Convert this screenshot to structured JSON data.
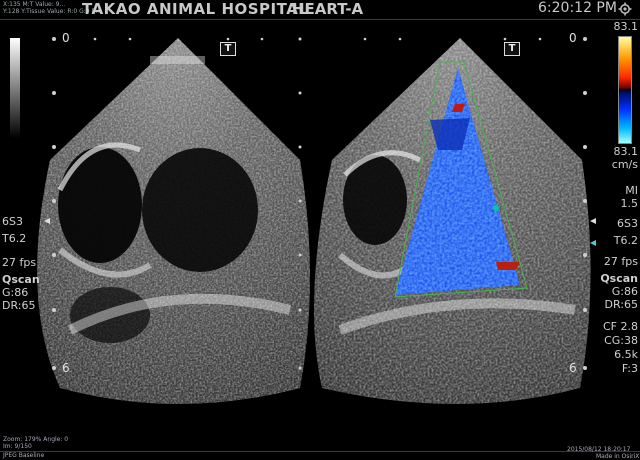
{
  "header": {
    "info_line1": "X:135 M:T Value: 9...",
    "info_line2": "Y:128  Y:Tissue Value: R:0 G:0 B:0",
    "hospital": "TAKAO ANIMAL HOSPITAL",
    "preset": "HEART-A",
    "time": "6:20:12 PM"
  },
  "left_panel": {
    "depth_top": "0",
    "depth_bottom": "6",
    "probe": "6S3",
    "tissue_freq": "T6.2",
    "fps": "27 fps",
    "mode": "Qscan",
    "gain": "G:86",
    "dynamic_range": "DR:65",
    "marker": "T"
  },
  "right_panel": {
    "depth_top": "0",
    "depth_bottom": "6",
    "scale_top": "83.1",
    "scale_bottom": "83.1",
    "scale_unit": "cm/s",
    "mi_label": "MI",
    "mi_value": "1.5",
    "probe": "6S3",
    "tissue_freq": "T6.2",
    "fps": "27 fps",
    "mode": "Qscan",
    "gain": "G:86",
    "dynamic_range": "DR:65",
    "cf_freq": "CF 2.8",
    "color_gain": "CG:38",
    "prf": "6.5k",
    "filter": "F:3",
    "marker": "T"
  },
  "footer": {
    "zoom": "Zoom: 179%  Angle: 0",
    "image_count": "Im: 9/150",
    "compression": "JPEG Baseline",
    "datetime": "2015/08/12 18:20:17",
    "made_in": "Made in OsiriX"
  },
  "colors": {
    "background": "#000000",
    "text": "#cfcfcf",
    "doppler_blue": "#1a5cff",
    "sector_outline": "#4caf50"
  }
}
